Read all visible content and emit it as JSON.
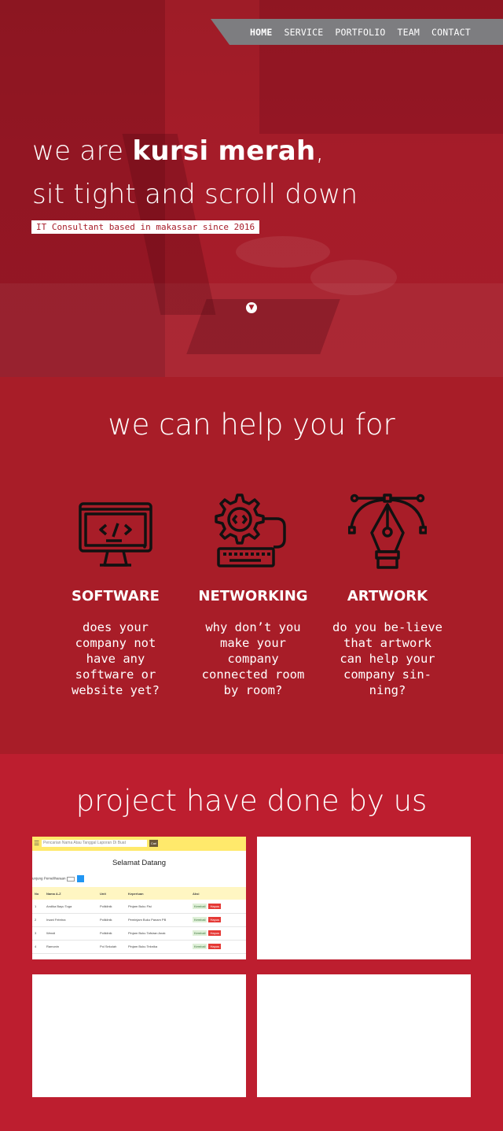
{
  "nav": {
    "items": [
      "HOME",
      "SERVICE",
      "PORTFOLIO",
      "TEAM",
      "CONTACT"
    ],
    "active_index": 0
  },
  "hero": {
    "title_prefix": "we are ",
    "title_brand": "kursi merah",
    "title_suffix": ",",
    "title_line2": "sit tight and scroll down",
    "tagline": "IT Consultant based in makassar since 2016",
    "scroll_icon": "chevron-down-icon"
  },
  "services": {
    "heading": "we can help you for",
    "items": [
      {
        "icon": "monitor-code-icon",
        "title": "SOFTWARE",
        "text": "does your company not have any software or website yet?"
      },
      {
        "icon": "gear-keyboard-icon",
        "title": "NETWORKING",
        "text": "why don’t you make your company connected room by room?"
      },
      {
        "icon": "pen-tool-icon",
        "title": "ARTWORK",
        "text": "do you be-lieve that artwork can help your company sin-ning?"
      }
    ]
  },
  "projects": {
    "heading": "project have done by us",
    "preview": {
      "search_placeholder": "Pencarian Nama Atau Tanggal Laporan Di Buat",
      "search_button": "Cari",
      "welcome": "Selamat Datang",
      "filter_label": "unjung Pemeliharaan",
      "columns": [
        "No",
        "Nama A-Z",
        "Unit",
        "Keperluan",
        "Aksi"
      ],
      "rows": [
        [
          "1",
          "Andika Bayu Toga",
          "Poliklinik",
          "Pinjam Buku Fisi",
          "Kembali",
          "Hapus"
        ],
        [
          "2",
          "Irsani Febrina",
          "Poliklinik",
          "Peminjam Buku Panam PB",
          "Kembali",
          "Hapus"
        ],
        [
          "3",
          "Wendi",
          "Poliklinik",
          "Pinjam Buku Tafsiran Anak",
          "Kembali",
          "Hapus"
        ],
        [
          "4",
          "Ramonin",
          "Pol Sekolah",
          "Pinjam Buku Teknika",
          "Kembali",
          "Hapus"
        ]
      ]
    }
  }
}
